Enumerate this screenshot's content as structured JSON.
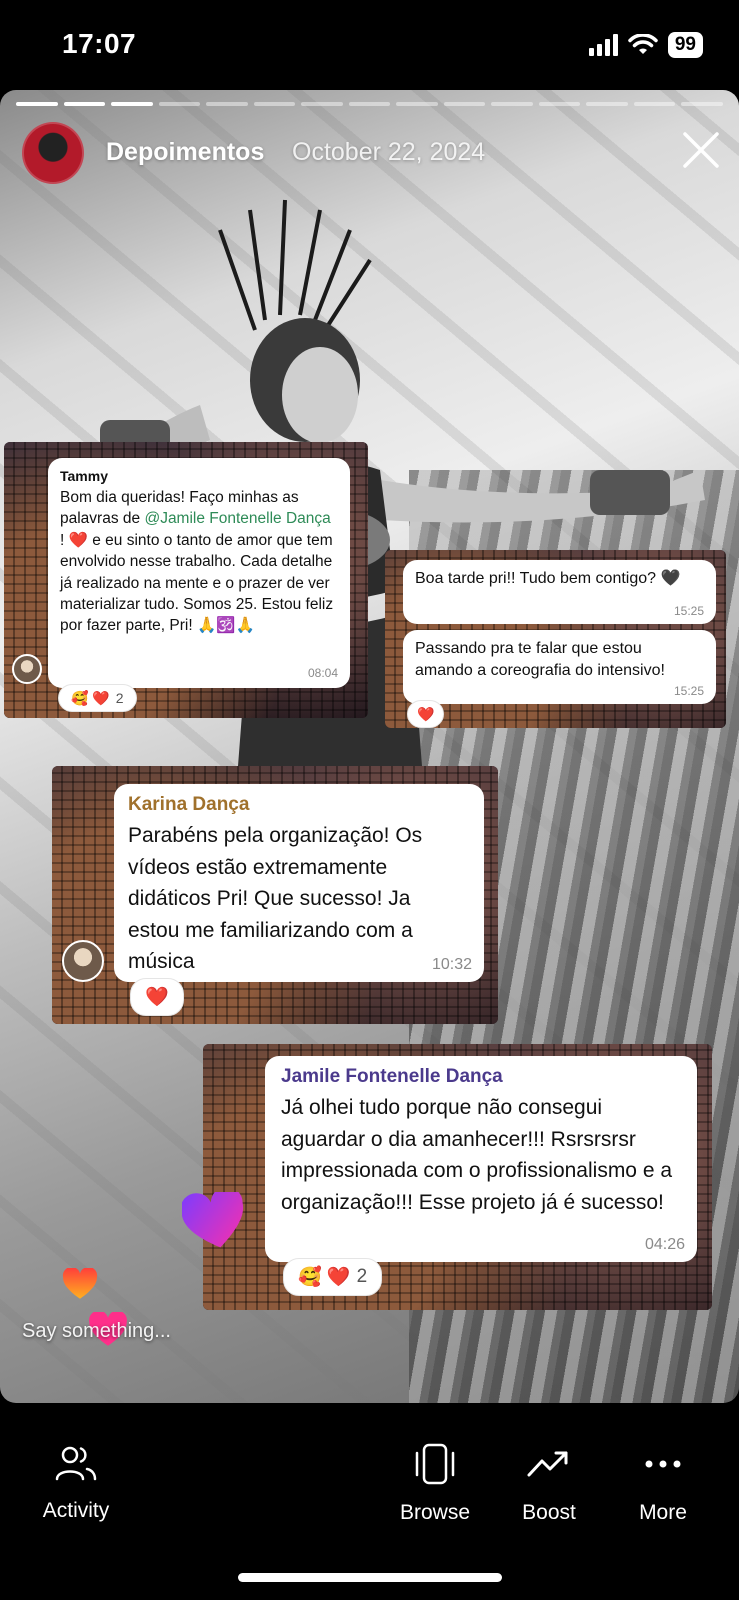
{
  "status_bar": {
    "time": "17:07",
    "battery": "99"
  },
  "story": {
    "account_name": "Depoimentos",
    "date": "October 22, 2024",
    "progress_segments": 15,
    "progress_done": 3,
    "reply_placeholder": "Say something..."
  },
  "messages": {
    "tammy": {
      "sender": "Tammy",
      "text_before": "Bom dia queridas! Faço minhas as palavras de ",
      "mention": "@Jamile Fontenelle Dança",
      "text_after": " ! ❤️ e eu sinto o tanto de amor que tem envolvido nesse trabalho. Cada detalhe já realizado na mente e o prazer de ver materializar tudo. Somos 25. Estou feliz por fazer parte, Pri! 🙏🕉️🙏",
      "time": "08:04",
      "reactions": "🥰 ❤️",
      "reaction_count": "2"
    },
    "pri_1": {
      "text": "Boa tarde pri!! Tudo bem contigo? 🖤",
      "time": "15:25"
    },
    "pri_2": {
      "text": "Passando pra te falar que estou amando a coreografia do intensivo!",
      "time": "15:25",
      "reactions": "❤️"
    },
    "karina": {
      "sender": "Karina Dança",
      "text": "Parabéns pela organização! Os vídeos estão extremamente didáticos Pri! Que sucesso! Ja estou me familiarizando com a música",
      "time": "10:32",
      "reactions": "❤️"
    },
    "jamile": {
      "sender": "Jamile Fontenelle Dança",
      "text": "Já olhei tudo porque não consegui aguardar o dia amanhecer!!! Rsrsrsrsr impressionada com o profissionalismo e a organização!!! Esse projeto já é sucesso!",
      "time": "04:26",
      "reactions": "🥰 ❤️",
      "reaction_count": "2"
    }
  },
  "bottom_nav": {
    "activity": "Activity",
    "browse": "Browse",
    "boost": "Boost",
    "more": "More"
  },
  "colors": {
    "tammy_name": "#3a6ea5",
    "mention": "#2e8b57",
    "karina_name": "#a0712c",
    "jamile_name": "#4b3a8c"
  }
}
